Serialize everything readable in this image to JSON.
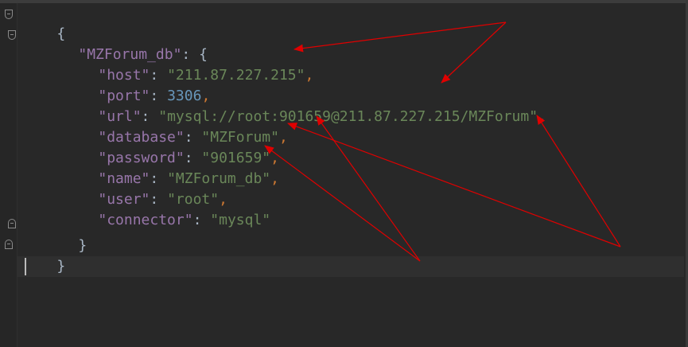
{
  "editor": {
    "lines": [
      {
        "text": "{"
      },
      {
        "key": "\"MZForum_db\"",
        "sep": ": ",
        "tail": "{"
      },
      {
        "key": "\"host\"",
        "sep": ": ",
        "value": "\"211.87.227.215\"",
        "comma": ","
      },
      {
        "key": "\"port\"",
        "sep": ": ",
        "value": "3306",
        "comma": ","
      },
      {
        "key": "\"url\"",
        "sep": ": ",
        "value": "\"mysql://root:901659@211.87.227.215/MZForum\"",
        "comma": ","
      },
      {
        "key": "\"database\"",
        "sep": ": ",
        "value": "\"MZForum\"",
        "comma": ","
      },
      {
        "key": "\"password\"",
        "sep": ": ",
        "value": "\"901659\"",
        "comma": ","
      },
      {
        "key": "\"name\"",
        "sep": ": ",
        "value": "\"MZForum_db\"",
        "comma": ","
      },
      {
        "key": "\"user\"",
        "sep": ": ",
        "value": "\"root\"",
        "comma": ","
      },
      {
        "key": "\"connector\"",
        "sep": ": ",
        "value": "\"mysql\""
      },
      {
        "text": "}"
      },
      {
        "text": "}"
      }
    ]
  },
  "colors": {
    "background": "#282828",
    "key": "#9876aa",
    "string": "#6a8759",
    "number": "#6897bb",
    "punctuation": "#cc7832",
    "annotation_arrow": "#e00000"
  },
  "icons": {
    "fold_open": "fold-open-icon",
    "fold_close": "fold-close-icon"
  }
}
